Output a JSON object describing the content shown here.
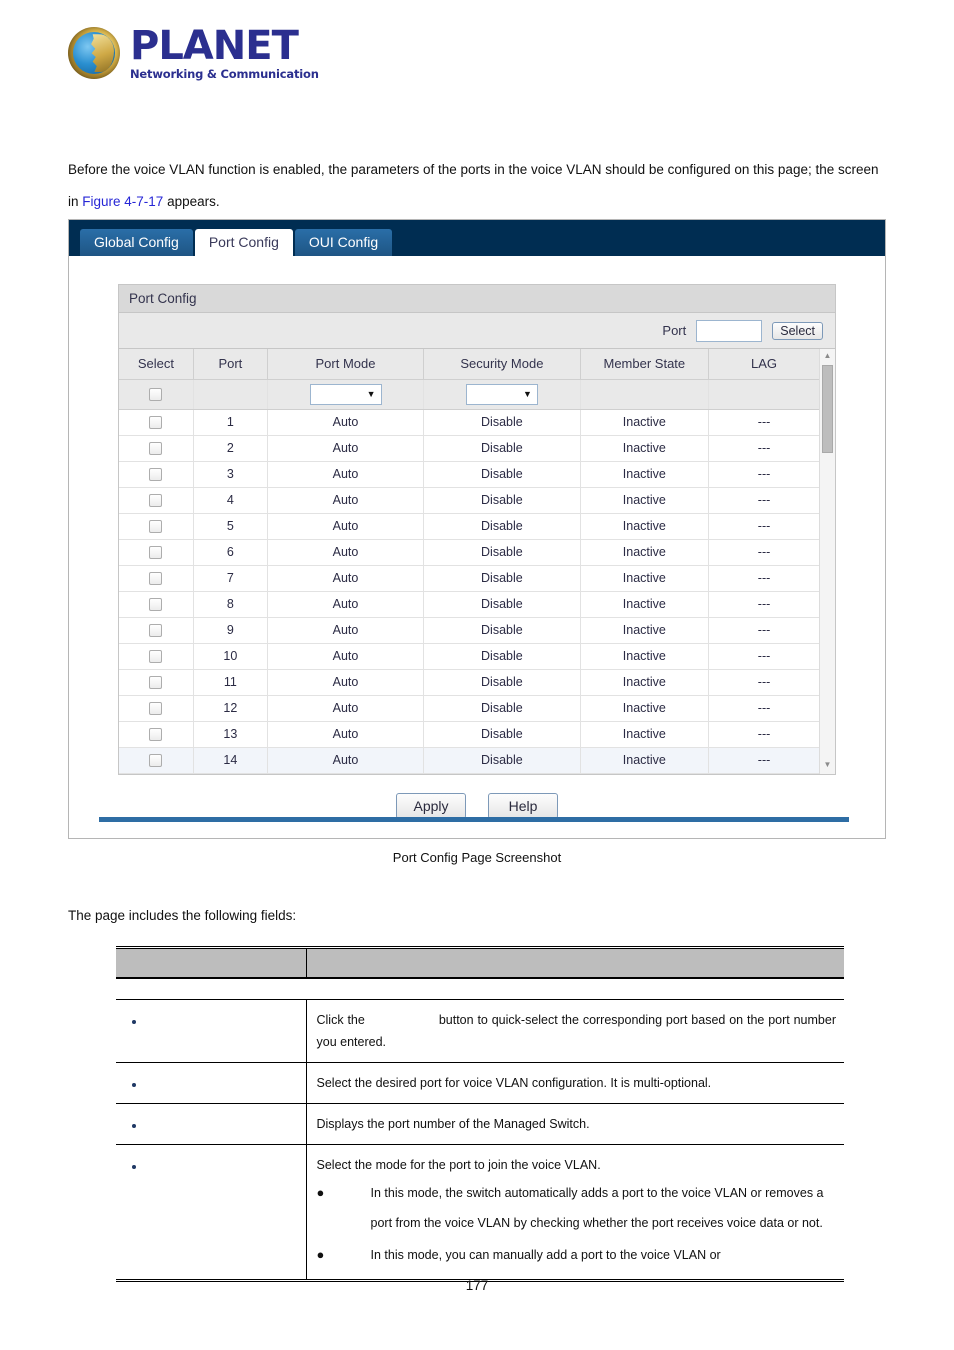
{
  "brand": {
    "name": "PLANET",
    "tagline": "Networking & Communication",
    "logo_icon": "planet-globe-logo"
  },
  "intro": {
    "line1_before_link": "Before the voice VLAN function is enabled, the parameters of the ports in the voice VLAN should be configured on this page; the screen in ",
    "link_text": "Figure 4-7-17",
    "line1_after_link": " appears."
  },
  "screenshot": {
    "tabs": [
      {
        "label": "Global Config",
        "active": false
      },
      {
        "label": "Port Config",
        "active": true
      },
      {
        "label": "OUI Config",
        "active": false
      }
    ],
    "panel_title": "Port Config",
    "filter": {
      "port_label": "Port",
      "port_value": "",
      "port_placeholder": "",
      "select_button": "Select"
    },
    "columns": [
      "Select",
      "Port",
      "Port Mode",
      "Security Mode",
      "Member State",
      "LAG"
    ],
    "filter_row": {
      "port_mode_value": "",
      "security_mode_value": ""
    },
    "rows": [
      {
        "port": "1",
        "port_mode": "Auto",
        "security_mode": "Disable",
        "member_state": "Inactive",
        "lag": "---"
      },
      {
        "port": "2",
        "port_mode": "Auto",
        "security_mode": "Disable",
        "member_state": "Inactive",
        "lag": "---"
      },
      {
        "port": "3",
        "port_mode": "Auto",
        "security_mode": "Disable",
        "member_state": "Inactive",
        "lag": "---"
      },
      {
        "port": "4",
        "port_mode": "Auto",
        "security_mode": "Disable",
        "member_state": "Inactive",
        "lag": "---"
      },
      {
        "port": "5",
        "port_mode": "Auto",
        "security_mode": "Disable",
        "member_state": "Inactive",
        "lag": "---"
      },
      {
        "port": "6",
        "port_mode": "Auto",
        "security_mode": "Disable",
        "member_state": "Inactive",
        "lag": "---"
      },
      {
        "port": "7",
        "port_mode": "Auto",
        "security_mode": "Disable",
        "member_state": "Inactive",
        "lag": "---"
      },
      {
        "port": "8",
        "port_mode": "Auto",
        "security_mode": "Disable",
        "member_state": "Inactive",
        "lag": "---"
      },
      {
        "port": "9",
        "port_mode": "Auto",
        "security_mode": "Disable",
        "member_state": "Inactive",
        "lag": "---"
      },
      {
        "port": "10",
        "port_mode": "Auto",
        "security_mode": "Disable",
        "member_state": "Inactive",
        "lag": "---"
      },
      {
        "port": "11",
        "port_mode": "Auto",
        "security_mode": "Disable",
        "member_state": "Inactive",
        "lag": "---"
      },
      {
        "port": "12",
        "port_mode": "Auto",
        "security_mode": "Disable",
        "member_state": "Inactive",
        "lag": "---"
      },
      {
        "port": "13",
        "port_mode": "Auto",
        "security_mode": "Disable",
        "member_state": "Inactive",
        "lag": "---"
      },
      {
        "port": "14",
        "port_mode": "Auto",
        "security_mode": "Disable",
        "member_state": "Inactive",
        "lag": "---"
      }
    ],
    "buttons": {
      "apply": "Apply",
      "help": "Help"
    },
    "colors": {
      "tabbar": "#002d52",
      "tab_inactive": "#1e5584",
      "rule": "#2e6da4"
    }
  },
  "caption": "Port Config Page Screenshot",
  "fields_note": "The page includes the following fields:",
  "desc_table": {
    "header": {
      "col1": "",
      "col2": ""
    },
    "rows": [
      {
        "label": "",
        "text_a": "Click the",
        "text_b": "button to quick-select the corresponding port based on the port number you entered.",
        "subitems": []
      },
      {
        "label": "",
        "text_a": "Select the desired port for voice VLAN configuration. It is multi-optional.",
        "text_b": "",
        "subitems": []
      },
      {
        "label": "",
        "text_a": "Displays the port number of the Managed Switch.",
        "text_b": "",
        "subitems": []
      },
      {
        "label": "",
        "text_a": "Select the mode for the port to join the voice VLAN.",
        "text_b": "",
        "subitems": [
          "In this mode, the switch automatically adds a port to the voice VLAN or removes a port from the voice VLAN by checking whether the port receives voice data or not.",
          "In this mode, you can manually add a port to the voice VLAN or"
        ]
      }
    ]
  },
  "page_number": "177"
}
